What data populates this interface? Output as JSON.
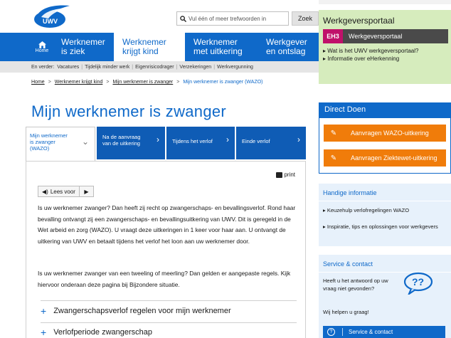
{
  "header": {
    "search_placeholder": "Vul één of meer trefwoorden in",
    "search_button": "Zoek"
  },
  "portal": {
    "title": "Werkgeversportaal",
    "eh_badge": "EH3",
    "button_label": "Werkgeversportaal",
    "links": [
      "Wat is het UWV werkgeversportaal?",
      "Informatie over eHerkenning"
    ]
  },
  "nav": {
    "home_label": "Home",
    "items": [
      {
        "line1": "Werknemer",
        "line2": "is ziek"
      },
      {
        "line1": "Werknemer",
        "line2": "krijgt kind"
      },
      {
        "line1": "Werknemer",
        "line2": "met uitkering"
      },
      {
        "line1": "Werkgever",
        "line2": "en ontslag"
      }
    ]
  },
  "subnav": {
    "prefix": "En verder:",
    "items": [
      "Vacatures",
      "Tijdelijk minder werk",
      "Eigenrisicodrager",
      "Verzekeringen",
      "Werkvergunning"
    ]
  },
  "breadcrumb": [
    "Home",
    "Werknemer krijgt kind",
    "Mijn werknemer is zwanger",
    "Mijn werknemer is zwanger (WAZO)"
  ],
  "page_title": "Mijn werknemer is zwanger",
  "tabs": [
    {
      "line1": "Mijn werknemer",
      "line2": "is zwanger",
      "line3": "(WAZO)"
    },
    {
      "line1": "Na de aanvraag",
      "line2": "van de uitkering"
    },
    {
      "line1": "Tijdens het verlof",
      "line2": ""
    },
    {
      "line1": "Einde verlof",
      "line2": ""
    }
  ],
  "content": {
    "print_label": "print",
    "read_label": "Lees voor",
    "para1": "Is uw werknemer zwanger? Dan heeft zij recht op zwangerschaps- en bevallingsverlof. Rond haar bevalling ontvangt zij een zwangerschaps- en bevallingsuitkering van UWV. Dit is geregeld in de Wet arbeid en zorg (WAZO). U vraagt deze uitkeringen in 1 keer voor haar aan. U ontvangt de uitkering van UWV en betaalt tijdens het verlof het loon aan uw werknemer door.",
    "para2": "Is uw werknemer zwanger van een tweeling of meerling? Dan gelden er aangepaste regels. Kijk hiervoor onderaan deze pagina bij Bijzondere situatie.",
    "accordions": [
      "Zwangerschapsverlof regelen voor mijn werknemer",
      "Verlofperiode zwangerschap"
    ]
  },
  "direct_doen": {
    "title": "Direct Doen",
    "buttons": [
      "Aanvragen WAZO-uitkering",
      "Aanvragen Ziektewet-uitkering"
    ]
  },
  "handige_info": {
    "title": "Handige informatie",
    "links": [
      "Keuzehulp verlofregelingen WAZO",
      "Inspiratie, tips en oplossingen voor werkgevers"
    ]
  },
  "service": {
    "title": "Service & contact",
    "question": "Heeft u het antwoord op uw vraag niet gevonden?",
    "help": "Wij helpen u graag!",
    "button": "Service & contact"
  },
  "colors": {
    "primary": "#0f69c9",
    "orange": "#f07c0a",
    "green_panel": "#d6ecbd",
    "light_blue": "#e7f1fb"
  }
}
